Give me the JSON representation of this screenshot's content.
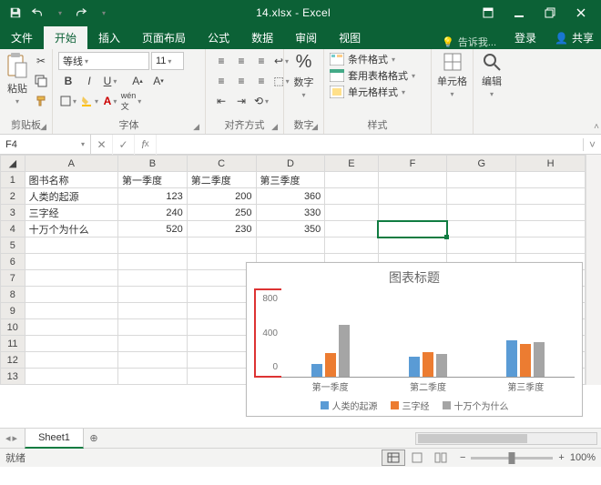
{
  "title": "14.xlsx - Excel",
  "ribbon_tabs": [
    "文件",
    "开始",
    "插入",
    "页面布局",
    "公式",
    "数据",
    "审阅",
    "视图"
  ],
  "active_tab": 1,
  "tell_me": "告诉我...",
  "signin": "登录",
  "share": "共享",
  "clipboard": {
    "paste": "粘贴",
    "label": "剪贴板"
  },
  "font": {
    "name": "等线",
    "size": "11",
    "label": "字体"
  },
  "align": {
    "label": "对齐方式"
  },
  "number": {
    "btn": "数字",
    "label": "数字"
  },
  "styles": {
    "cond": "条件格式",
    "table": "套用表格格式",
    "cell": "单元格样式",
    "label": "样式"
  },
  "cells_group": {
    "label": "单元格"
  },
  "editing_group": {
    "label": "编辑"
  },
  "namebox": "F4",
  "formula": "",
  "columns": [
    "",
    "A",
    "B",
    "C",
    "D",
    "E",
    "F",
    "G",
    "H"
  ],
  "rows": [
    {
      "n": "1",
      "A": "图书名称",
      "B": "第一季度",
      "C": "第二季度",
      "D": "第三季度"
    },
    {
      "n": "2",
      "A": "人类的起源",
      "B": "123",
      "C": "200",
      "D": "360"
    },
    {
      "n": "3",
      "A": "三字经",
      "B": "240",
      "C": "250",
      "D": "330"
    },
    {
      "n": "4",
      "A": "十万个为什么",
      "B": "520",
      "C": "230",
      "D": "350"
    },
    {
      "n": "5"
    },
    {
      "n": "6"
    },
    {
      "n": "7"
    },
    {
      "n": "8"
    },
    {
      "n": "9"
    },
    {
      "n": "10"
    },
    {
      "n": "11"
    },
    {
      "n": "12"
    },
    {
      "n": "13"
    }
  ],
  "selected_cell": "F4",
  "chart_data": {
    "type": "bar",
    "title": "图表标题",
    "categories": [
      "第一季度",
      "第二季度",
      "第三季度"
    ],
    "series": [
      {
        "name": "人类的起源",
        "values": [
          123,
          200,
          360
        ],
        "color": "#5a9bd5"
      },
      {
        "name": "三字经",
        "values": [
          240,
          250,
          330
        ],
        "color": "#ec7c31"
      },
      {
        "name": "十万个为什么",
        "values": [
          520,
          230,
          350
        ],
        "color": "#a5a5a5"
      }
    ],
    "yticks": [
      "800",
      "400",
      "0"
    ],
    "ylim": [
      0,
      800
    ]
  },
  "sheet": "Sheet1",
  "status": "就绪",
  "zoom": "100%"
}
